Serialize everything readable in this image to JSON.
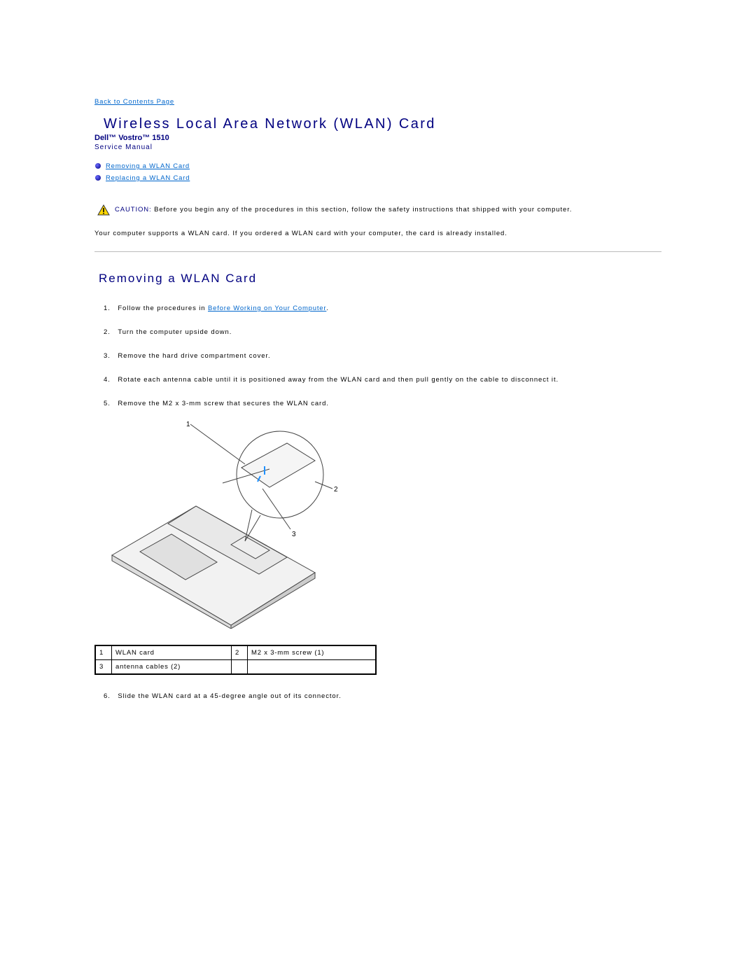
{
  "back_link": "Back to Contents Page",
  "title": "Wireless Local Area Network (WLAN) Card",
  "product": "Dell™ Vostro™ 1510",
  "manual": "Service Manual",
  "toc": [
    "Removing a WLAN Card",
    "Replacing a WLAN Card"
  ],
  "caution": {
    "label": "CAUTION:",
    "text": "Before you begin any of the procedures in this section, follow the safety instructions that shipped with your computer."
  },
  "intro": "Your computer supports a WLAN card. If you ordered a WLAN card with your computer, the card is already installed.",
  "section_title": "Removing a WLAN Card",
  "steps": [
    {
      "num": "1.",
      "pre": "Follow the procedures in ",
      "link": "Before Working on Your Computer",
      "post": "."
    },
    {
      "num": "2.",
      "text": "Turn the computer upside down."
    },
    {
      "num": "3.",
      "text": "Remove the hard drive compartment cover."
    },
    {
      "num": "4.",
      "text": "Rotate each antenna cable until it is positioned away from the WLAN card and then pull gently on the cable to disconnect it."
    },
    {
      "num": "5.",
      "text": "Remove the M2 x 3-mm screw that secures the WLAN card."
    },
    {
      "num": "6.",
      "text": "Slide the WLAN card at a 45-degree angle out of its connector."
    }
  ],
  "callouts": [
    "1",
    "2",
    "3"
  ],
  "legend": [
    [
      "1",
      "WLAN card",
      "2",
      "M2 x 3-mm screw (1)"
    ],
    [
      "3",
      "antenna cables (2)",
      "",
      ""
    ]
  ]
}
